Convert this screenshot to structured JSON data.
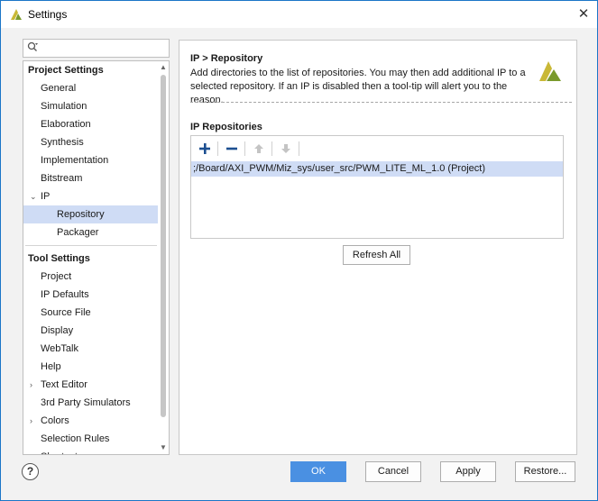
{
  "window": {
    "title": "Settings",
    "close_glyph": "✕",
    "app_icon": "vivado-logo-icon"
  },
  "search": {
    "icon_glyph": "Q",
    "value": ""
  },
  "sidebar": {
    "project_settings": {
      "header": "Project Settings",
      "items": [
        {
          "label": "General"
        },
        {
          "label": "Simulation"
        },
        {
          "label": "Elaboration"
        },
        {
          "label": "Synthesis"
        },
        {
          "label": "Implementation"
        },
        {
          "label": "Bitstream"
        },
        {
          "label": "IP",
          "expanded": true,
          "toggle": "⌄"
        },
        {
          "label": "Repository",
          "selected": true
        },
        {
          "label": "Packager"
        }
      ]
    },
    "tool_settings": {
      "header": "Tool Settings",
      "items": [
        {
          "label": "Project"
        },
        {
          "label": "IP Defaults"
        },
        {
          "label": "Source File"
        },
        {
          "label": "Display"
        },
        {
          "label": "WebTalk"
        },
        {
          "label": "Help"
        },
        {
          "label": "Text Editor",
          "toggle": "›"
        },
        {
          "label": "3rd Party Simulators"
        },
        {
          "label": "Colors",
          "toggle": "›"
        },
        {
          "label": "Selection Rules"
        },
        {
          "label": "Shortcuts"
        }
      ]
    }
  },
  "content": {
    "breadcrumb": "IP > Repository",
    "description": "Add directories to the list of repositories. You may then add additional IP to a selected repository. If an IP is disabled then a tool-tip will alert you to the reason.",
    "section_title": "IP Repositories",
    "toolbar": {
      "add_glyph": "+",
      "remove_glyph": "−",
      "up_glyph": "⬆",
      "down_glyph": "⬇"
    },
    "repositories": [
      ";/Board/AXI_PWM/Miz_sys/user_src/PWM_LITE_ML_1.0 (Project)"
    ],
    "refresh_label": "Refresh All"
  },
  "footer": {
    "help_glyph": "?",
    "ok_label": "OK",
    "cancel_label": "Cancel",
    "apply_label": "Apply",
    "restore_label": "Restore..."
  },
  "colors": {
    "accent": "#4a90e2",
    "selection": "#cfdcf5",
    "logo_yellow": "#c9b836",
    "logo_green": "#7a9a2c"
  }
}
